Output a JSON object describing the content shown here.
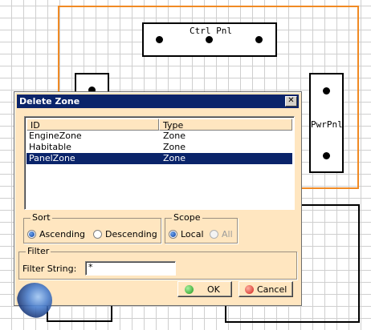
{
  "canvas": {
    "ctrl_panel_label": "Ctrl Pnl",
    "pwr_panel_label": "PwrPnl"
  },
  "dialog": {
    "title": "Delete Zone",
    "close_symbol": "✕",
    "list": {
      "columns": [
        "ID",
        "Type"
      ],
      "rows": [
        {
          "id": "EngineZone",
          "type": "Zone",
          "selected": false
        },
        {
          "id": "Habitable",
          "type": "Zone",
          "selected": false
        },
        {
          "id": "PanelZone",
          "type": "Zone",
          "selected": true
        }
      ]
    },
    "sort": {
      "label": "Sort",
      "options": [
        {
          "label": "Ascending",
          "checked": true
        },
        {
          "label": "Descending",
          "checked": false
        }
      ]
    },
    "scope": {
      "label": "Scope",
      "options": [
        {
          "label": "Local",
          "checked": true,
          "enabled": true
        },
        {
          "label": "All",
          "checked": false,
          "enabled": false
        }
      ]
    },
    "filter": {
      "label": "Filter",
      "field_label": "Filter String:",
      "value": "*"
    },
    "buttons": {
      "ok": "OK",
      "cancel": "Cancel"
    },
    "icons": {
      "ok": "green-dot-icon",
      "cancel": "red-dot-icon",
      "radio_selected_color": "#0a3fa5"
    },
    "colors": {
      "title_bar": "#0a246a",
      "dialog_bg": "#ffe6c0",
      "selection": "#0a246a",
      "orange_frame": "#f08a24"
    }
  }
}
